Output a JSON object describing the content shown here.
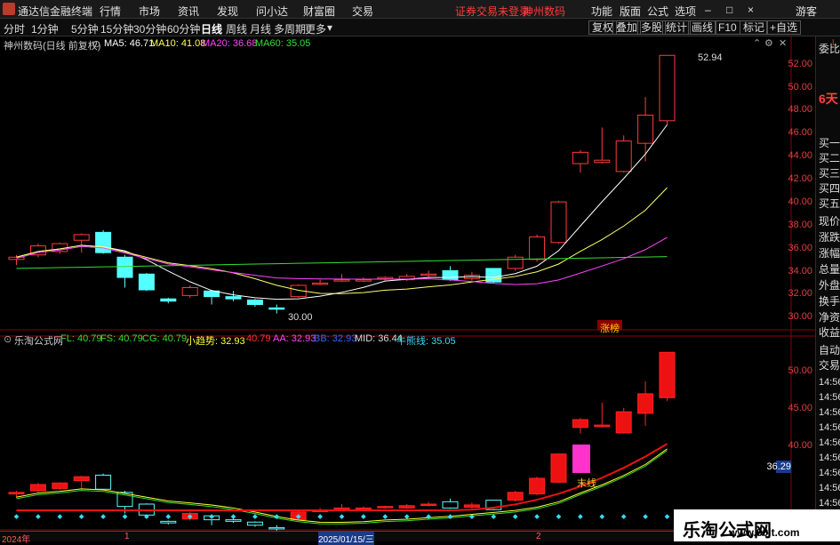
{
  "menubar": {
    "app_title": "通达信金融终端",
    "items": [
      "行情",
      "市场",
      "资讯",
      "发现",
      "问小达",
      "财富圈",
      "交易"
    ],
    "login_notice": "证券交易未登录",
    "stock": "神州数码",
    "right_items": [
      "功能",
      "版面",
      "公式",
      "选项"
    ],
    "guest": "游客",
    "window_controls": [
      "–",
      "□",
      "×"
    ]
  },
  "periodbar": {
    "items": [
      "分时",
      "1分钟",
      "5分钟",
      "15分钟",
      "30分钟",
      "60分钟",
      "日线",
      "周线",
      "月线",
      "多周期",
      "更多"
    ],
    "active": "日线",
    "tools": [
      "复权",
      "叠加",
      "多股",
      "统计",
      "画线",
      "F10",
      "标记",
      "+自选"
    ]
  },
  "main_chart": {
    "header_name": "神州数码(日线 前复权)",
    "ma": [
      {
        "label": "MA5: 46.71",
        "color": "#ffffff"
      },
      {
        "label": "MA10: 41.08",
        "color": "#ffff66"
      },
      {
        "label": "MA20: 36.68",
        "color": "#ff44ff"
      },
      {
        "label": "MA60: 35.05",
        "color": "#33dd33"
      }
    ],
    "high_label": "52.94",
    "low_label": "30.00",
    "tag": "涨榜",
    "y_ticks": [
      "52.00",
      "50.00",
      "48.00",
      "46.00",
      "44.00",
      "42.00",
      "40.00",
      "38.00",
      "36.00",
      "34.00",
      "32.00",
      "30.00"
    ]
  },
  "sub_chart": {
    "header_name": "乐淘公式网",
    "labels": [
      {
        "t": "FL: 40.79",
        "c": "#33dd33"
      },
      {
        "t": "FS: 40.79",
        "c": "#33dd33"
      },
      {
        "t": "CG: 40.79",
        "c": "#33dd33"
      },
      {
        "t": "小趋势: 32.93",
        "c": "#ffff33"
      },
      {
        "t": "40.79",
        "c": "#ff3333"
      },
      {
        "t": "AA: 32.93",
        "c": "#ff44ff"
      },
      {
        "t": "BB: 32.93",
        "c": "#3366ff"
      },
      {
        "t": "MID: 36.44",
        "c": "#dddddd"
      },
      {
        "t": "牛熊线: 35.05",
        "c": "#33ddff"
      }
    ],
    "y_ticks": [
      "50.00",
      "45.00",
      "40.00"
    ],
    "price_tag": "36.29",
    "marker": "末线"
  },
  "side": {
    "top": [
      "委比"
    ],
    "days": "6天",
    "list": [
      "买一",
      "买二",
      "买三",
      "买四",
      "买五",
      "现价",
      "涨跌",
      "涨幅",
      "总量",
      "外盘",
      "换手",
      "净资",
      "收益"
    ],
    "lower": [
      "自动",
      "交易"
    ],
    "times": [
      "14:56",
      "14:56",
      "14:56",
      "14:56",
      "14:56",
      "14:56",
      "14:56",
      "14:56",
      "14:56"
    ],
    "corner": "L"
  },
  "footer": {
    "labels": [
      "2024年",
      "1",
      "2025/01/15/三",
      "2"
    ]
  },
  "watermark": {
    "line1": "乐淘公式网",
    "line2": "www.60lt.com"
  },
  "chart_data": {
    "type": "candlestick",
    "title": "神州数码(日线 前复权)",
    "ylim": [
      29.5,
      53
    ],
    "candles": [
      [
        34.8,
        35.0,
        34.3,
        35.2
      ],
      [
        35.2,
        36.0,
        35.0,
        36.2
      ],
      [
        35.5,
        36.2,
        35.3,
        36.3
      ],
      [
        36.5,
        37.0,
        35.4,
        37.1
      ],
      [
        37.2,
        35.4,
        35.3,
        37.4
      ],
      [
        35.0,
        33.2,
        32.3,
        35.2
      ],
      [
        33.5,
        32.1,
        32.0,
        33.6
      ],
      [
        31.3,
        31.1,
        30.9,
        31.4
      ],
      [
        31.6,
        32.3,
        31.4,
        32.5
      ],
      [
        32.0,
        31.5,
        30.8,
        32.1
      ],
      [
        31.5,
        31.3,
        31.1,
        32.0
      ],
      [
        31.2,
        30.8,
        30.6,
        31.3
      ],
      [
        30.5,
        30.4,
        30.0,
        30.8
      ],
      [
        31.5,
        32.5,
        31.4,
        32.6
      ],
      [
        32.6,
        32.7,
        32.5,
        33.0
      ],
      [
        32.9,
        33.0,
        32.8,
        33.5
      ],
      [
        32.9,
        33.0,
        32.8,
        33.2
      ],
      [
        33.1,
        33.2,
        32.9,
        33.3
      ],
      [
        33.0,
        33.3,
        32.9,
        33.5
      ],
      [
        33.4,
        33.5,
        33.2,
        33.8
      ],
      [
        33.8,
        33.0,
        32.9,
        34.2
      ],
      [
        33.1,
        33.4,
        32.9,
        33.7
      ],
      [
        34.0,
        32.8,
        32.7,
        34.0
      ],
      [
        34.0,
        35.0,
        33.8,
        35.2
      ],
      [
        34.8,
        36.8,
        34.6,
        37.0
      ],
      [
        36.3,
        39.9,
        36.2,
        40.0
      ],
      [
        43.3,
        44.3,
        42.5,
        44.5
      ],
      [
        43.4,
        43.6,
        43.3,
        46.5
      ],
      [
        42.6,
        45.3,
        42.5,
        45.8
      ],
      [
        45.1,
        47.6,
        43.5,
        49.2
      ],
      [
        47.1,
        52.9,
        46.7,
        52.9
      ]
    ]
  }
}
